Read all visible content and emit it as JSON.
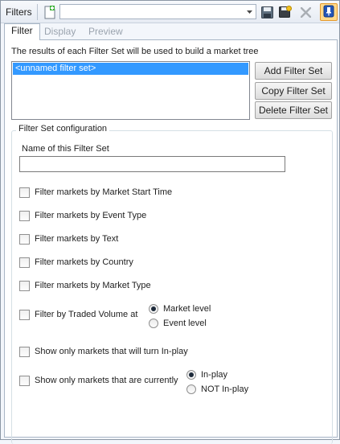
{
  "toolbar": {
    "title": "Filters",
    "filter_set_combo_value": "",
    "icons": [
      "new-document-icon",
      "save-icon",
      "save-as-icon",
      "delete-icon",
      "pin-icon"
    ]
  },
  "tabs": [
    {
      "label": "Filter",
      "active": true
    },
    {
      "label": "Display",
      "active": false
    },
    {
      "label": "Preview",
      "active": false
    }
  ],
  "filter": {
    "intro": "The results of each Filter Set will be used to build a market tree",
    "filter_sets": [
      "<unnamed filter set>"
    ],
    "buttons": {
      "add": "Add Filter Set",
      "copy": "Copy Filter Set",
      "delete": "Delete Filter Set"
    },
    "config": {
      "legend": "Filter Set configuration",
      "name_label": "Name of this Filter Set",
      "name_value": "",
      "checks": [
        {
          "label": "Filter markets by Market Start Time",
          "checked": false
        },
        {
          "label": "Filter markets by Event Type",
          "checked": false
        },
        {
          "label": "Filter markets by Text",
          "checked": false
        },
        {
          "label": "Filter markets by Country",
          "checked": false
        },
        {
          "label": "Filter markets by Market Type",
          "checked": false
        },
        {
          "label": "Filter by Traded Volume at",
          "checked": false
        },
        {
          "label": "Show only markets that will turn In-play",
          "checked": false
        },
        {
          "label": "Show only markets that are currently",
          "checked": false
        }
      ],
      "volume_level": {
        "options": [
          "Market level",
          "Event level"
        ],
        "selected": "Market level"
      },
      "inplay_state": {
        "options": [
          "In-play",
          "NOT In-play"
        ],
        "selected": "In-play"
      }
    }
  },
  "colors": {
    "selection": "#3399ff",
    "window_bg": "#f3f6fb",
    "pin_button": "#ffd98a"
  }
}
